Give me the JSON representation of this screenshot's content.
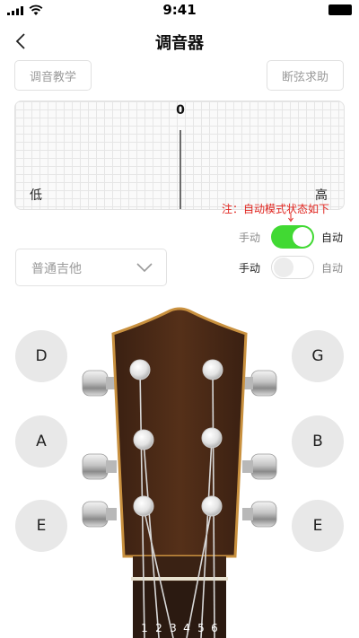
{
  "status": {
    "time": "9:41"
  },
  "nav": {
    "title": "调音器"
  },
  "buttons": {
    "teach": "调音教学",
    "help": "断弦求助"
  },
  "meter": {
    "center": "0",
    "low": "低",
    "high": "高"
  },
  "note": "注：自动模式状态如下",
  "toggles": [
    {
      "left": "手动",
      "right": "自动",
      "state": "on"
    },
    {
      "left": "手动",
      "right": "自动",
      "state": "off"
    }
  ],
  "tuning": {
    "selected": "普通吉他"
  },
  "strings_left": [
    "D",
    "A",
    "E"
  ],
  "strings_right": [
    "G",
    "B",
    "E"
  ],
  "string_numbers": [
    "1",
    "2",
    "3",
    "4",
    "5",
    "6"
  ],
  "colors": {
    "accent_green": "#41d933",
    "note_red": "#e0251f",
    "wood": "#4a2a18",
    "binding": "#c9913f"
  }
}
